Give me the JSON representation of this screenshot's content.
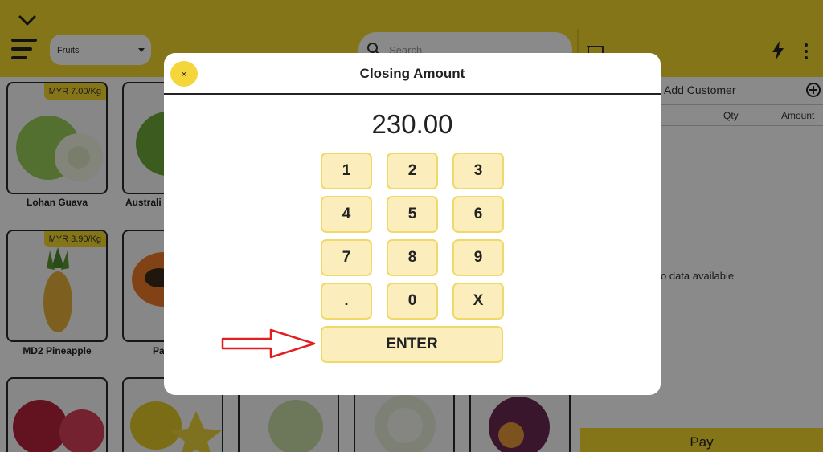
{
  "background": {
    "category_select": "Fruits",
    "search_placeholder": "Search",
    "products": [
      {
        "name": "Lohan Guava",
        "price": "MYR 7.00/Kg"
      },
      {
        "name": "Australi",
        "price": ""
      },
      {
        "name": "MD2 Pineapple",
        "price": "MYR 3.90/Kg"
      },
      {
        "name": "Pa",
        "price": ""
      }
    ],
    "side_panel": {
      "add_customer": "Add Customer",
      "col_qty": "Qty",
      "col_amount": "Amount",
      "empty_text": "o data available",
      "pay_label": "Pay"
    }
  },
  "modal": {
    "title": "Closing Amount",
    "close_label": "×",
    "amount": "230.00",
    "keys": [
      "1",
      "2",
      "3",
      "4",
      "5",
      "6",
      "7",
      "8",
      "9",
      ".",
      "0",
      "X"
    ],
    "enter_label": "ENTER"
  },
  "colors": {
    "accent": "#f5d92f",
    "key_bg": "#fbeebc",
    "key_border": "#efd968",
    "arrow": "#e02020"
  },
  "icons": [
    "chevron-down-icon",
    "hamburger-icon",
    "search-icon",
    "cart-icon",
    "bolt-icon",
    "more-vertical-icon",
    "add-circle-icon",
    "close-icon",
    "arrow-right-icon"
  ]
}
